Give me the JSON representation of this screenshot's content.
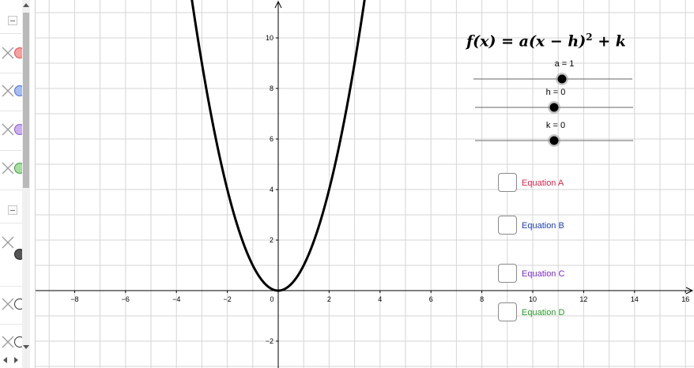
{
  "algebra_view": {
    "rows": [
      {
        "color": "#f4a0a0",
        "ring": "#e05050"
      },
      {
        "color": "#a8bdf0",
        "ring": "#4a6fd0"
      },
      {
        "color": "#cbb0f0",
        "ring": "#8a5ad0"
      },
      {
        "color": "#a8dca0",
        "ring": "#3f9f3f"
      }
    ],
    "extra_dot_color": "#555555"
  },
  "graph": {
    "x_ticks": [
      "−8",
      "−6",
      "−4",
      "−2",
      "0",
      "2",
      "4",
      "6",
      "8",
      "10",
      "12",
      "14",
      "16"
    ],
    "y_ticks": [
      "10",
      "8",
      "6",
      "4",
      "2",
      "−2"
    ],
    "curve": {
      "a": 1,
      "h": 0,
      "k": 0,
      "color": "#000000"
    }
  },
  "formula": {
    "lhs": "f(x) = a(x − h)",
    "exponent": "2",
    "rhs": " + k"
  },
  "sliders": [
    {
      "label": "a = 1",
      "value": 1
    },
    {
      "label": "h = 0",
      "value": 0
    },
    {
      "label": "k = 0",
      "value": 0
    }
  ],
  "checkboxes": [
    {
      "label": "Equation A",
      "color": "#d6264f",
      "checked": false
    },
    {
      "label": "Equation B",
      "color": "#1e3fa8",
      "checked": false
    },
    {
      "label": "Equation C",
      "color": "#7a2cc0",
      "checked": false
    },
    {
      "label": "Equation D",
      "color": "#2a9a2a",
      "checked": false
    }
  ]
}
